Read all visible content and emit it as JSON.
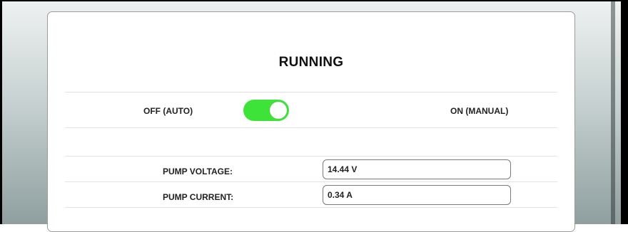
{
  "status": {
    "title": "RUNNING"
  },
  "mode_toggle": {
    "off_label": "OFF (AUTO)",
    "on_label": "ON (MANUAL)",
    "state": "on",
    "active_color": "#3ee33a"
  },
  "readings": {
    "pump_voltage": {
      "label": "PUMP VOLTAGE:",
      "value": "14.44 V"
    },
    "pump_current": {
      "label": "PUMP CURRENT:",
      "value": "0.34 A"
    }
  }
}
